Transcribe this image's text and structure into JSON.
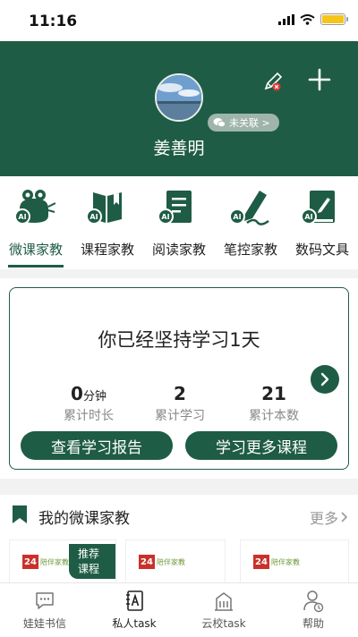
{
  "status_bar": {
    "time": "11:16"
  },
  "profile": {
    "name": "姜善明",
    "wechat_status": "未关联 >"
  },
  "tabs": [
    {
      "label": "微课家教",
      "icon": "frog-ai-icon",
      "active": true
    },
    {
      "label": "课程家教",
      "icon": "book-ai-icon",
      "active": false
    },
    {
      "label": "阅读家教",
      "icon": "reader-ai-icon",
      "active": false
    },
    {
      "label": "笔控家教",
      "icon": "pen-ai-icon",
      "active": false
    },
    {
      "label": "数码文具",
      "icon": "notebook-ai-icon",
      "active": false
    }
  ],
  "tab_badge": "AI",
  "progress_card": {
    "title": "你已经坚持学习1天",
    "stats": [
      {
        "value": "0",
        "unit": "分钟",
        "label": "累计时长"
      },
      {
        "value": "2",
        "unit": "",
        "label": "累计学习"
      },
      {
        "value": "21",
        "unit": "",
        "label": "累计本数"
      }
    ],
    "report_button": "查看学习报告",
    "more_courses_button": "学习更多课程"
  },
  "my_courses": {
    "title": "我的微课家教",
    "more_link": "更多",
    "recommended_tag": "推荐课程",
    "logo_number": "24",
    "logo_caption": "陪伴家教"
  },
  "bottom_nav": [
    {
      "label": "娃娃书信",
      "icon": "chat-bubble-icon",
      "active": false
    },
    {
      "label": "私人task",
      "icon": "notebook-a-icon",
      "active": true
    },
    {
      "label": "云校task",
      "icon": "school-building-icon",
      "active": false
    },
    {
      "label": "帮助",
      "icon": "help-person-icon",
      "active": false
    }
  ],
  "colors": {
    "primary": "#1f5c45",
    "header_bg": "#1f5c45",
    "badge_bg": "#9fb5ab",
    "battery": "#f5c518",
    "logo_red": "#c9312a"
  }
}
